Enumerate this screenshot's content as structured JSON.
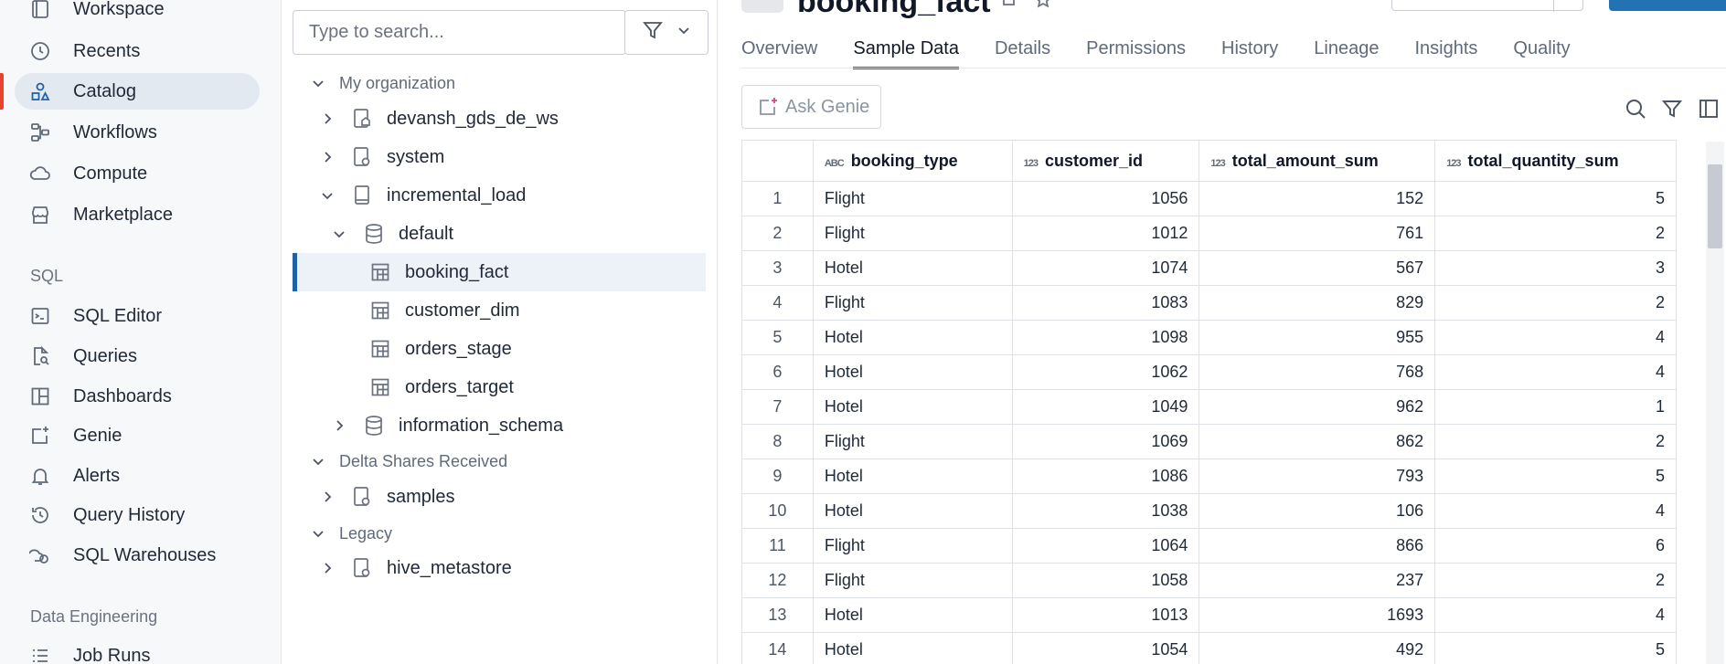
{
  "nav": {
    "items": [
      {
        "label": "Workspace",
        "icon": "workspace-icon"
      },
      {
        "label": "Recents",
        "icon": "clock-icon"
      },
      {
        "label": "Catalog",
        "icon": "catalog-icon"
      },
      {
        "label": "Workflows",
        "icon": "workflows-icon"
      },
      {
        "label": "Compute",
        "icon": "cloud-icon"
      },
      {
        "label": "Marketplace",
        "icon": "store-icon"
      },
      {
        "label": "SQL Editor",
        "icon": "sql-editor-icon"
      },
      {
        "label": "Queries",
        "icon": "queries-icon"
      },
      {
        "label": "Dashboards",
        "icon": "dashboards-icon"
      },
      {
        "label": "Genie",
        "icon": "genie-icon"
      },
      {
        "label": "Alerts",
        "icon": "bell-icon"
      },
      {
        "label": "Query History",
        "icon": "history-icon"
      },
      {
        "label": "SQL Warehouses",
        "icon": "warehouse-icon"
      },
      {
        "label": "Job Runs",
        "icon": "list-icon"
      }
    ],
    "sections": {
      "sql": "SQL",
      "data_engineering": "Data Engineering"
    }
  },
  "tree": {
    "search_placeholder": "Type to search...",
    "groups": [
      "My organization",
      "Delta Shares Received",
      "Legacy"
    ],
    "nodes": {
      "devansh": "devansh_gds_de_ws",
      "system": "system",
      "incremental_load": "incremental_load",
      "default": "default",
      "booking_fact": "booking_fact",
      "customer_dim": "customer_dim",
      "orders_stage": "orders_stage",
      "orders_target": "orders_target",
      "information_schema": "information_schema",
      "samples": "samples",
      "hive_metastore": "hive_metastore"
    }
  },
  "main": {
    "title": "booking_fact",
    "tabs": [
      "Overview",
      "Sample Data",
      "Details",
      "Permissions",
      "History",
      "Lineage",
      "Insights",
      "Quality"
    ],
    "active_tab": "Sample Data",
    "ask_genie": "Ask Genie"
  },
  "table": {
    "columns": [
      {
        "name": "booking_type",
        "type_icon": "ABC"
      },
      {
        "name": "customer_id",
        "type_icon": "123"
      },
      {
        "name": "total_amount_sum",
        "type_icon": "123"
      },
      {
        "name": "total_quantity_sum",
        "type_icon": "123"
      }
    ],
    "rows": [
      [
        "1",
        "Flight",
        "1056",
        "152",
        "5"
      ],
      [
        "2",
        "Flight",
        "1012",
        "761",
        "2"
      ],
      [
        "3",
        "Hotel",
        "1074",
        "567",
        "3"
      ],
      [
        "4",
        "Flight",
        "1083",
        "829",
        "2"
      ],
      [
        "5",
        "Hotel",
        "1098",
        "955",
        "4"
      ],
      [
        "6",
        "Hotel",
        "1062",
        "768",
        "4"
      ],
      [
        "7",
        "Hotel",
        "1049",
        "962",
        "1"
      ],
      [
        "8",
        "Flight",
        "1069",
        "862",
        "2"
      ],
      [
        "9",
        "Hotel",
        "1086",
        "793",
        "5"
      ],
      [
        "10",
        "Hotel",
        "1038",
        "106",
        "4"
      ],
      [
        "11",
        "Flight",
        "1064",
        "866",
        "6"
      ],
      [
        "12",
        "Flight",
        "1058",
        "237",
        "2"
      ],
      [
        "13",
        "Hotel",
        "1013",
        "1693",
        "4"
      ],
      [
        "14",
        "Hotel",
        "1054",
        "492",
        "5"
      ]
    ]
  },
  "colors": {
    "accent": "#2161a8",
    "active_marker": "#e8432f",
    "primary_button": "#2272b4"
  }
}
